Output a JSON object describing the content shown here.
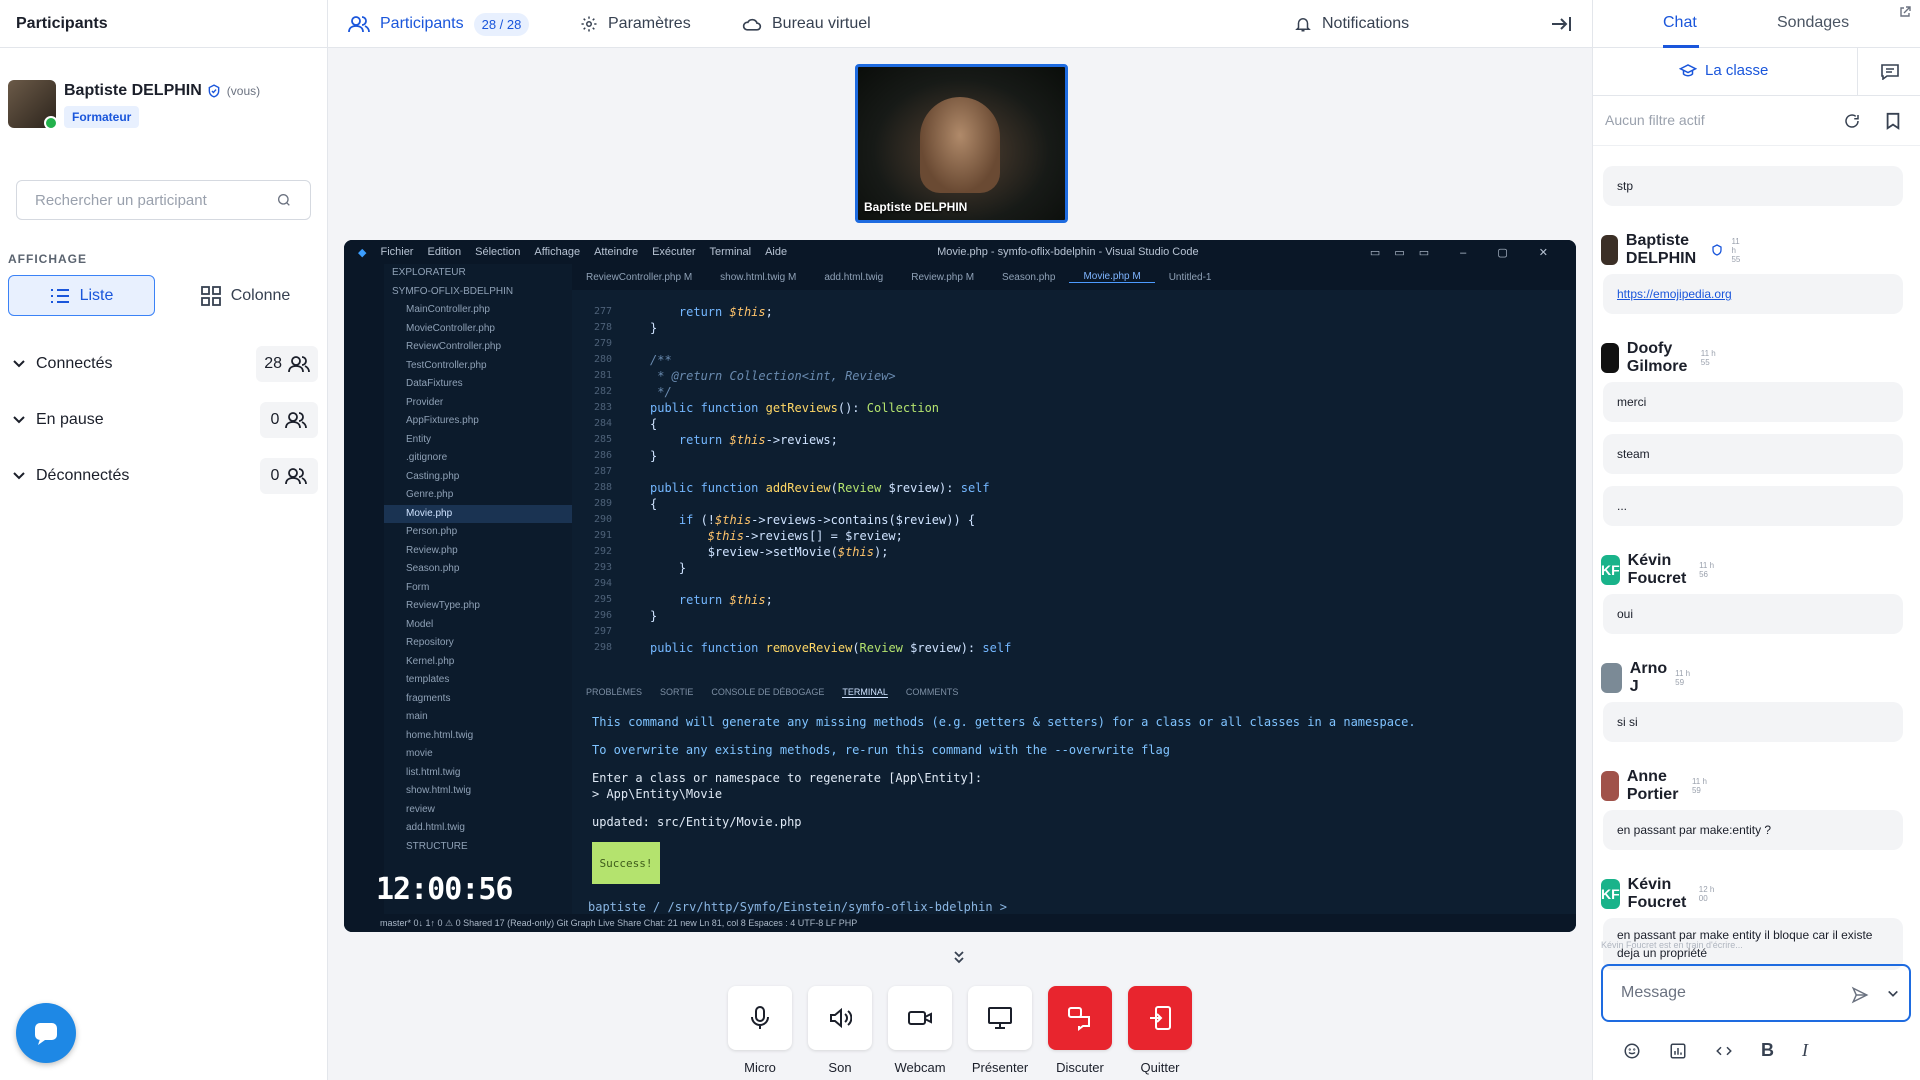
{
  "left": {
    "title": "Participants",
    "me": {
      "name": "Baptiste DELPHIN",
      "you": "(vous)",
      "role": "Formateur"
    },
    "search_placeholder": "Rechercher un participant",
    "display_label": "AFFICHAGE",
    "view_list": "Liste",
    "view_column": "Colonne",
    "groups": [
      {
        "label": "Connectés",
        "count": "28"
      },
      {
        "label": "En pause",
        "count": "0"
      },
      {
        "label": "Déconnectés",
        "count": "0"
      }
    ]
  },
  "topbar": {
    "participants": "Participants",
    "participants_count": "28 / 28",
    "settings": "Paramètres",
    "office": "Bureau virtuel",
    "notifications": "Notifications"
  },
  "stage": {
    "camera_name": "Baptiste DELPHIN",
    "clock": "12:00:56",
    "vscode_title": "Movie.php - symfo-oflix-bdelphin - Visual Studio Code",
    "vscode_menu": [
      "Fichier",
      "Edition",
      "Sélection",
      "Affichage",
      "Atteindre",
      "Exécuter",
      "Terminal",
      "Aide"
    ],
    "tabs": [
      "ReviewController.php M",
      "show.html.twig M",
      "add.html.twig",
      "Review.php M",
      "Season.php",
      "Movie.php M",
      "Untitled-1"
    ],
    "explorer": [
      "EXPLORATEUR",
      "SYMFO-OFLIX-BDELPHIN",
      "MainController.php",
      "MovieController.php",
      "ReviewController.php",
      "TestController.php",
      "DataFixtures",
      "Provider",
      "AppFixtures.php",
      "Entity",
      ".gitignore",
      "Casting.php",
      "Genre.php",
      "Movie.php",
      "Person.php",
      "Review.php",
      "Season.php",
      "Form",
      "ReviewType.php",
      "Model",
      "Repository",
      "Kernel.php",
      "templates",
      "fragments",
      "main",
      "home.html.twig",
      "movie",
      "list.html.twig",
      "show.html.twig",
      "review",
      "add.html.twig",
      "STRUCTURE"
    ],
    "term_tabs": [
      "PROBLÈMES",
      "SORTIE",
      "CONSOLE DE DÉBOGAGE",
      "TERMINAL",
      "COMMENTS"
    ],
    "term_lines": [
      "This command will generate any missing methods (e.g. getters & setters) for a class or all classes in a namespace.",
      "",
      "To overwrite any existing methods, re-run this command with the --overwrite flag",
      "",
      "Enter a class or namespace to regenerate [App\\Entity]:",
      "> App\\Entity\\Movie",
      "",
      "updated: src/Entity/Movie.php"
    ],
    "success": "Success!",
    "prompt": "baptiste / /srv/http/Symfo/Einstein/symfo-oflix-bdelphin >",
    "status": "master*   0↓ 1↑   0 ⚠ 0   Shared   17 (Read-only)   Git Graph   Live Share Chat: 21 new        Ln 81, col 8   Espaces : 4   UTF-8   LF   PHP"
  },
  "controls": [
    {
      "label": "Micro",
      "icon": "mic-icon",
      "danger": false
    },
    {
      "label": "Son",
      "icon": "speaker-icon",
      "danger": false
    },
    {
      "label": "Webcam",
      "icon": "camera-icon",
      "danger": false
    },
    {
      "label": "Présenter",
      "icon": "monitor-icon",
      "danger": false
    },
    {
      "label": "Discuter",
      "icon": "chat-icon",
      "danger": true
    },
    {
      "label": "Quitter",
      "icon": "exit-icon",
      "danger": true
    }
  ],
  "right": {
    "tab_chat": "Chat",
    "tab_polls": "Sondages",
    "class_label": "La classe",
    "filter": "Aucun filtre actif",
    "typing": "Kévin Foucret est en train d'écrire...",
    "message_placeholder": "Message",
    "messages": [
      {
        "text": "stp"
      },
      {
        "author": "Baptiste DELPHIN",
        "time": "11 h 55",
        "text": "https://emojipedia.org"
      },
      {
        "author": "Doofy Gilmore",
        "time": "11 h 55",
        "text": "merci"
      },
      {
        "text": "steam"
      },
      {
        "text": "..."
      },
      {
        "author": "Kévin Foucret",
        "initials": "KF",
        "time": "11 h 56",
        "text": "oui"
      },
      {
        "author": "Arno J",
        "time": "11 h 59",
        "text": "si si"
      },
      {
        "author": "Anne Portier",
        "time": "11 h 59",
        "text": "en passant par make:entity ?"
      },
      {
        "author": "Kévin Foucret",
        "initials": "KF",
        "time": "12 h 00",
        "text": "en passant par make entity il bloque car il existe deja un propriété"
      }
    ]
  },
  "colors": {
    "accent": "#1a56db",
    "danger": "#e8252e",
    "success": "#22b14c"
  }
}
